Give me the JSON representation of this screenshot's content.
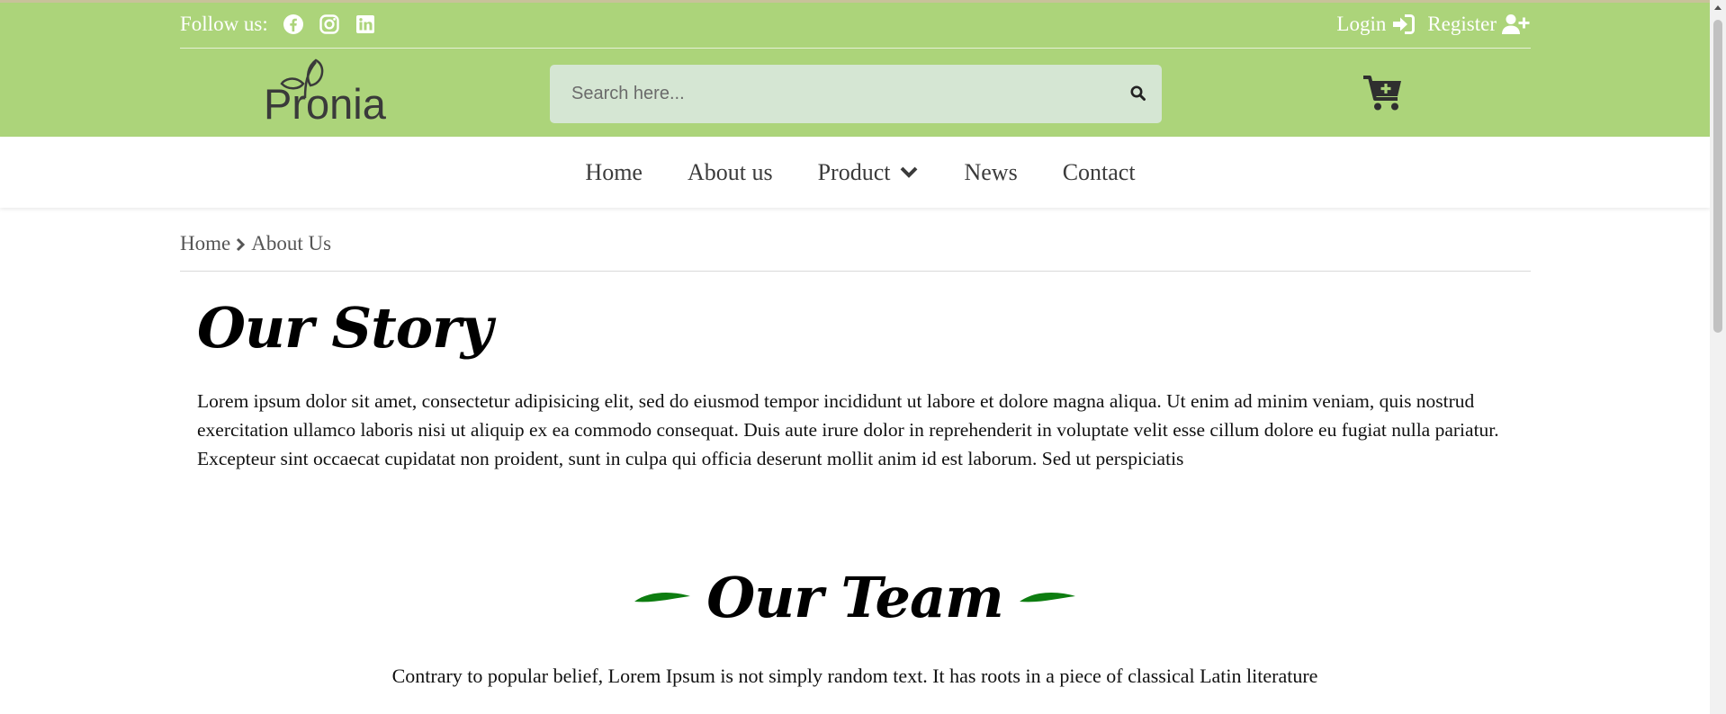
{
  "header": {
    "follow_label": "Follow us:",
    "social": [
      "facebook-icon",
      "instagram-icon",
      "linkedin-icon"
    ],
    "login_label": "Login",
    "register_label": "Register",
    "logo_text": "Pronia",
    "search_placeholder": "Search here...",
    "accent_color": "#acd47a"
  },
  "nav": {
    "items": [
      {
        "label": "Home"
      },
      {
        "label": "About us"
      },
      {
        "label": "Product"
      },
      {
        "label": "News"
      },
      {
        "label": "Contact"
      }
    ]
  },
  "breadcrumb": {
    "home": "Home",
    "current": "About Us"
  },
  "story": {
    "title": "Our Story",
    "text": "Lorem ipsum dolor sit amet, consectetur adipisicing elit, sed do eiusmod tempor incididunt ut labore et dolore magna aliqua. Ut enim ad minim veniam, quis nostrud exercitation ullamco laboris nisi ut aliquip ex ea commodo consequat. Duis aute irure dolor in reprehenderit in voluptate velit esse cillum dolore eu fugiat nulla pariatur. Excepteur sint occaecat cupidatat non proident, sunt in culpa qui officia deserunt mollit anim id est laborum. Sed ut perspiciatis"
  },
  "team": {
    "title": "Our Team",
    "text": "Contrary to popular belief, Lorem Ipsum is not simply random text. It has roots in a piece of classical Latin literature",
    "leaf_color": "#0d7d10"
  }
}
